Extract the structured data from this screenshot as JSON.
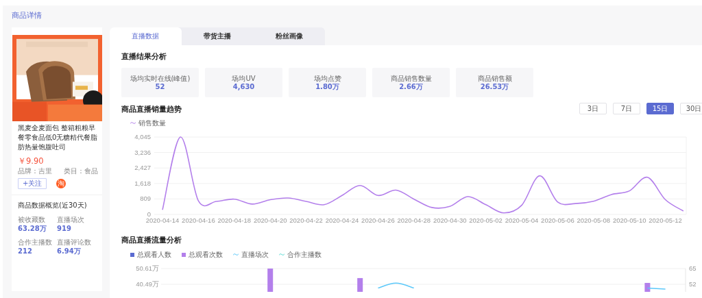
{
  "page_title": "商品详情",
  "product": {
    "name": "黑麦全麦面包 整箱粗粮早餐零食品低0无糖精代餐脂肪热量饱腹吐司",
    "price": "￥9.90",
    "brand": "品牌：吉里",
    "category": "类目：食品",
    "follow_button": "+关注",
    "platform_badge": "淘",
    "overview_title": "商品数据概览(近30天)",
    "stats": [
      {
        "label": "被收藏数",
        "value": "63.28万"
      },
      {
        "label": "直播场次",
        "value": "919"
      },
      {
        "label": "合作主播数",
        "value": "212"
      },
      {
        "label": "直播评论数",
        "value": "6.94万"
      }
    ]
  },
  "tabs": [
    {
      "label": "直播数据",
      "selected": true
    },
    {
      "label": "带货主播",
      "selected": false
    },
    {
      "label": "粉丝画像",
      "selected": false
    }
  ],
  "result_section": {
    "title": "直播结果分析",
    "metrics": [
      {
        "label": "场均实时在线(峰值)",
        "value": "52"
      },
      {
        "label": "场均UV",
        "value": "4,630"
      },
      {
        "label": "场均点赞",
        "value": "1.80万"
      },
      {
        "label": "商品销售数量",
        "value": "2.66万"
      },
      {
        "label": "商品销售额",
        "value": "26.53万"
      }
    ]
  },
  "sales_trend": {
    "title": "商品直播销量趋势",
    "ranges": [
      {
        "label": "3日",
        "selected": false
      },
      {
        "label": "7日",
        "selected": false
      },
      {
        "label": "15日",
        "selected": true
      },
      {
        "label": "30日",
        "selected": false
      }
    ],
    "chart_data": {
      "type": "line",
      "grid": true,
      "categories": [
        "2020-04-14",
        null,
        "2020-04-16",
        null,
        "2020-04-18",
        null,
        "2020-04-20",
        null,
        "2020-04-22",
        null,
        "2020-04-24",
        null,
        "2020-04-26",
        null,
        "2020-04-28",
        null,
        "2020-04-30",
        null,
        "2020-05-02",
        null,
        "2020-05-04",
        null,
        "2020-05-06",
        null,
        "2020-05-08",
        null,
        "2020-05-10",
        null,
        "2020-05-12",
        null
      ],
      "ylim": [
        0,
        4045
      ],
      "yticks": [
        {
          "value": 0,
          "label": "0"
        },
        {
          "value": 809,
          "label": "809"
        },
        {
          "value": 1618,
          "label": "1,618"
        },
        {
          "value": 2427,
          "label": "2,427"
        },
        {
          "value": 3236,
          "label": "3,236"
        },
        {
          "value": 4045,
          "label": "4,045"
        }
      ],
      "series": [
        {
          "name": "销售数量",
          "color": "#b37feb",
          "values": [
            240,
            4045,
            710,
            680,
            800,
            540,
            770,
            860,
            680,
            510,
            990,
            1510,
            990,
            1270,
            800,
            360,
            420,
            930,
            510,
            80,
            480,
            2020,
            650,
            570,
            690,
            1040,
            1230,
            1940,
            770,
            180
          ]
        }
      ]
    }
  },
  "traffic": {
    "title": "商品直播流量分析",
    "chart_data": {
      "type": "bar",
      "grid": true,
      "ylim": [
        35.68,
        50.61
      ],
      "y2lim": [
        45.82,
        65
      ],
      "yticks": [
        {
          "value": 40.49,
          "label": "40.49万"
        },
        {
          "value": 50.61,
          "label": "50.61万"
        }
      ],
      "y2ticks": [
        52,
        65
      ],
      "series": [
        {
          "name": "总观看人数",
          "color": "#5b6bd1",
          "type": "bar"
        },
        {
          "name": "总观看次数",
          "color": "#b37feb",
          "type": "bar",
          "values": [
            null,
            null,
            null,
            null,
            null,
            null,
            50.6,
            null,
            null,
            null,
            null,
            44.5,
            null,
            null,
            null,
            null,
            null,
            null,
            null,
            null,
            null,
            null,
            null,
            null,
            null,
            null,
            null,
            41.4,
            null,
            null
          ]
        },
        {
          "name": "直播场次",
          "color": "#5ac8fa",
          "type": "line",
          "axis": "y2",
          "values": [
            null,
            null,
            null,
            null,
            null,
            null,
            null,
            null,
            null,
            null,
            null,
            null,
            49,
            53,
            49,
            null,
            null,
            null,
            null,
            null,
            null,
            null,
            null,
            null,
            null,
            null,
            null,
            49,
            48,
            null
          ]
        },
        {
          "name": "合作主播数",
          "color": "#5cdbd3",
          "type": "line"
        }
      ]
    }
  }
}
